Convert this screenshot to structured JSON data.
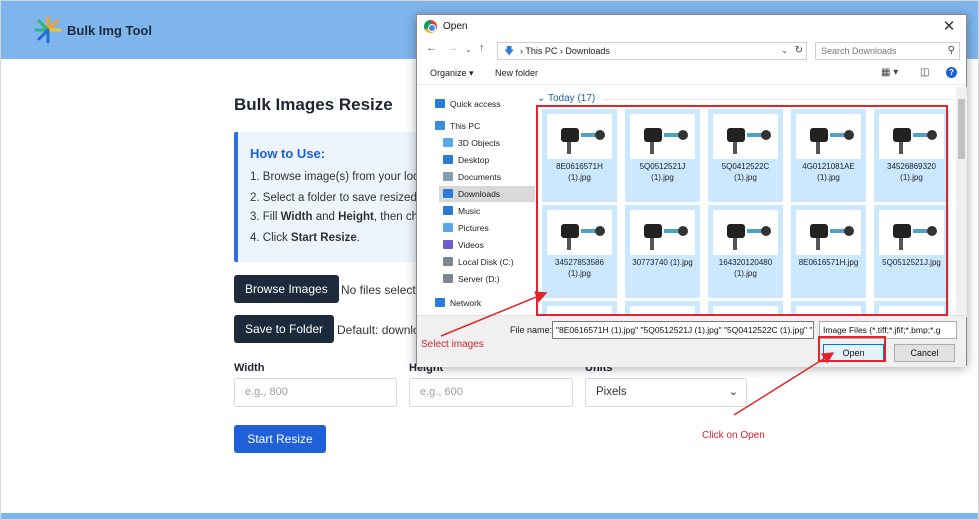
{
  "app": {
    "brand": "Bulk Img Tool",
    "page_title": "Bulk Images Resize",
    "how_to": {
      "title": "How to Use:",
      "steps": [
        "1. Browse image(s) from your loca",
        "2. Select a folder to save resized i",
        "3. Fill ",
        "4. Click "
      ],
      "step3_width": "Width",
      "step3_and": " and ",
      "step3_height": "Height",
      "step3_rest": ", then ch",
      "step4_bold": "Start Resize",
      "step4_end": "."
    },
    "browse_button": "Browse Images",
    "browse_status": "No files selecte",
    "save_button": "Save to Folder",
    "save_status": "Default: downlo",
    "width_label": "Width",
    "width_placeholder": "e.g., 800",
    "height_label": "Height",
    "height_placeholder": "e.g., 600",
    "units_label": "Units",
    "units_value": "Pixels",
    "start_button": "Start Resize"
  },
  "dialog": {
    "title": "Open",
    "breadcrumb": [
      "This PC",
      "Downloads"
    ],
    "breadcrumb_sep": "›",
    "search_placeholder": "Search Downloads",
    "organize": "Organize",
    "new_folder": "New folder",
    "nav_items": [
      {
        "label": "Quick access",
        "icon": "star-icon",
        "color": "#2b7bd9"
      },
      {
        "label": "This PC",
        "icon": "computer-icon",
        "color": "#3b8fd9"
      },
      {
        "label": "3D Objects",
        "icon": "cube-icon",
        "color": "#5aa7e8"
      },
      {
        "label": "Desktop",
        "icon": "desktop-icon",
        "color": "#2b7bd9"
      },
      {
        "label": "Documents",
        "icon": "document-icon",
        "color": "#8a9bb0"
      },
      {
        "label": "Downloads",
        "icon": "download-icon",
        "color": "#2b7bd9"
      },
      {
        "label": "Music",
        "icon": "music-icon",
        "color": "#2b7bd9"
      },
      {
        "label": "Pictures",
        "icon": "pictures-icon",
        "color": "#5aa7e8"
      },
      {
        "label": "Videos",
        "icon": "video-icon",
        "color": "#6a5acd"
      },
      {
        "label": "Local Disk (C:)",
        "icon": "disk-icon",
        "color": "#7d8792"
      },
      {
        "label": "Server (D:)",
        "icon": "disk-icon",
        "color": "#7d8792"
      },
      {
        "label": "Network",
        "icon": "network-icon",
        "color": "#2b7bd9"
      }
    ],
    "group_header": "Today (17)",
    "files": [
      {
        "l1": "8E0616571H",
        "l2": "(1).jpg"
      },
      {
        "l1": "5Q0512521J",
        "l2": "(1).jpg"
      },
      {
        "l1": "5Q0412522C",
        "l2": "(1).jpg"
      },
      {
        "l1": "4G0121081AE",
        "l2": "(1).jpg"
      },
      {
        "l1": "34526869320",
        "l2": "(1).jpg"
      },
      {
        "l1": "34527853586",
        "l2": "(1).jpg"
      },
      {
        "l1": "30773740 (1).jpg",
        "l2": ""
      },
      {
        "l1": "164320120480",
        "l2": "(1).jpg"
      },
      {
        "l1": "8E0616571H.jpg",
        "l2": ""
      },
      {
        "l1": "5Q0512521J.jpg",
        "l2": ""
      }
    ],
    "file_name_label": "File name:",
    "file_name_value": "\"8E0616571H (1).jpg\" \"5Q0512521J (1).jpg\" \"5Q0412522C (1).jpg\" \"",
    "file_type_value": "Image Files (*.tiff;*.jfif;*.bmp;*.g",
    "open_button": "Open",
    "cancel_button": "Cancel"
  },
  "annotations": {
    "select_images": "Select images",
    "click_open": "Click on Open",
    "color": "#e0262c"
  }
}
